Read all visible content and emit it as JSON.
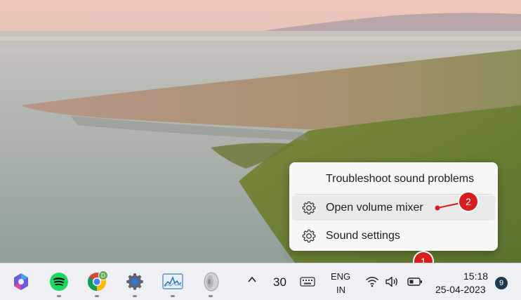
{
  "context_menu": {
    "items": [
      {
        "label": "Troubleshoot sound problems",
        "icon": null
      },
      {
        "label": "Open volume mixer",
        "icon": "gear-icon",
        "highlighted": true
      },
      {
        "label": "Sound settings",
        "icon": "gear-icon"
      }
    ]
  },
  "callouts": [
    {
      "number": "1",
      "color": "#d71c22"
    },
    {
      "number": "2",
      "color": "#d71c22"
    }
  ],
  "taskbar": {
    "apps": [
      {
        "name": "copilot-icon",
        "running": false
      },
      {
        "name": "spotify-icon",
        "running": true
      },
      {
        "name": "chrome-icon",
        "running": true,
        "badge": "D"
      },
      {
        "name": "settings-gear-icon",
        "running": true
      },
      {
        "name": "resource-monitor-icon",
        "running": true
      },
      {
        "name": "speaker-app-icon",
        "running": true
      }
    ],
    "tray": {
      "chevron": "^",
      "weather": "30",
      "language_line1": "ENG",
      "language_line2": "IN",
      "time": "15:18",
      "date": "25-04-2023",
      "notification_count": "9"
    }
  }
}
